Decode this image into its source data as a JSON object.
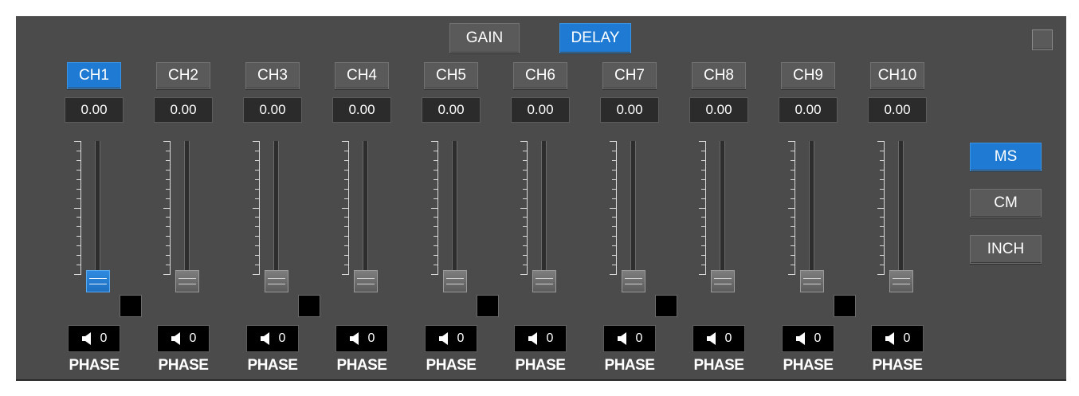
{
  "header": {
    "gain_label": "GAIN",
    "delay_label": "DELAY",
    "active_mode": "delay"
  },
  "units": {
    "buttons": [
      "MS",
      "CM",
      "INCH"
    ],
    "active": "MS"
  },
  "channels": [
    {
      "label": "CH1",
      "value": "0.00",
      "level": 0,
      "selected": true,
      "mute_value": "0",
      "phase_label": "PHASE",
      "has_indicator": true
    },
    {
      "label": "CH2",
      "value": "0.00",
      "level": 0,
      "selected": false,
      "mute_value": "0",
      "phase_label": "PHASE",
      "has_indicator": false
    },
    {
      "label": "CH3",
      "value": "0.00",
      "level": 0,
      "selected": false,
      "mute_value": "0",
      "phase_label": "PHASE",
      "has_indicator": true
    },
    {
      "label": "CH4",
      "value": "0.00",
      "level": 0,
      "selected": false,
      "mute_value": "0",
      "phase_label": "PHASE",
      "has_indicator": false
    },
    {
      "label": "CH5",
      "value": "0.00",
      "level": 0,
      "selected": false,
      "mute_value": "0",
      "phase_label": "PHASE",
      "has_indicator": true
    },
    {
      "label": "CH6",
      "value": "0.00",
      "level": 0,
      "selected": false,
      "mute_value": "0",
      "phase_label": "PHASE",
      "has_indicator": false
    },
    {
      "label": "CH7",
      "value": "0.00",
      "level": 0,
      "selected": false,
      "mute_value": "0",
      "phase_label": "PHASE",
      "has_indicator": true
    },
    {
      "label": "CH8",
      "value": "0.00",
      "level": 0,
      "selected": false,
      "mute_value": "0",
      "phase_label": "PHASE",
      "has_indicator": false
    },
    {
      "label": "CH9",
      "value": "0.00",
      "level": 0,
      "selected": false,
      "mute_value": "0",
      "phase_label": "PHASE",
      "has_indicator": true
    },
    {
      "label": "CH10",
      "value": "0.00",
      "level": 0,
      "selected": false,
      "mute_value": "0",
      "phase_label": "PHASE",
      "has_indicator": false
    }
  ],
  "icons": {
    "mute": "speaker-icon",
    "corner": "square-toggle"
  },
  "colors": {
    "panel": "#4b4b4b",
    "accent": "#1e7ad2",
    "button": "#5a5a5a"
  }
}
